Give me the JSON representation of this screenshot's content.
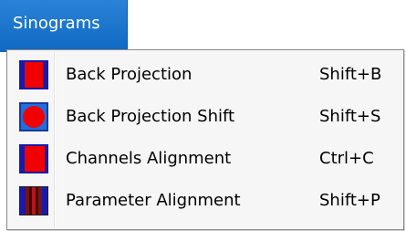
{
  "menubar": {
    "active_menu_label": "Sinograms"
  },
  "menu": {
    "items": [
      {
        "label": "Back Projection",
        "shortcut": "Shift+B",
        "icon": "back-projection-icon"
      },
      {
        "label": "Back Projection Shift",
        "shortcut": "Shift+S",
        "icon": "back-projection-shift-icon"
      },
      {
        "label": "Channels Alignment",
        "shortcut": "Ctrl+C",
        "icon": "channels-alignment-icon"
      },
      {
        "label": "Parameter Alignment",
        "shortcut": "Shift+P",
        "icon": "parameter-alignment-icon"
      }
    ]
  },
  "colors": {
    "menubar_accent": "#1a73cd",
    "icon_red": "#f00000",
    "icon_blue": "#1a1aa8",
    "menu_background": "#f6f6f6"
  }
}
